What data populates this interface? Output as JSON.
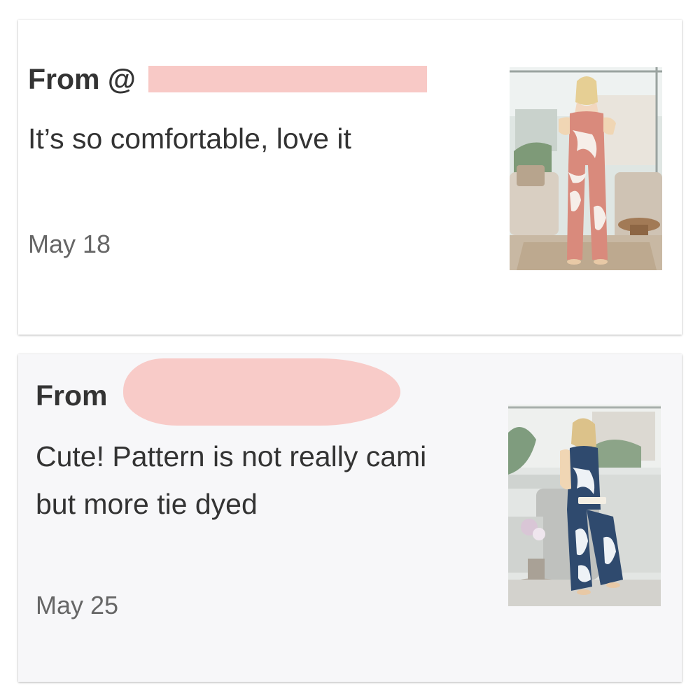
{
  "reviews": [
    {
      "from_label": "From @",
      "text": "It’s so comfortable, love it",
      "date": "May 18",
      "photo_icon": "pink-tie-dye-jumpsuit-photo",
      "outfit_color": "#d98a7c"
    },
    {
      "from_label": "From",
      "text": "Cute! Pattern is not really cami but more tie dyed",
      "date": "May 25",
      "photo_icon": "navy-tie-dye-jumpsuit-photo",
      "outfit_color": "#2f4a6e"
    }
  ],
  "colors": {
    "redaction": "#f8c9c6",
    "text": "#333333",
    "date": "#666666"
  }
}
